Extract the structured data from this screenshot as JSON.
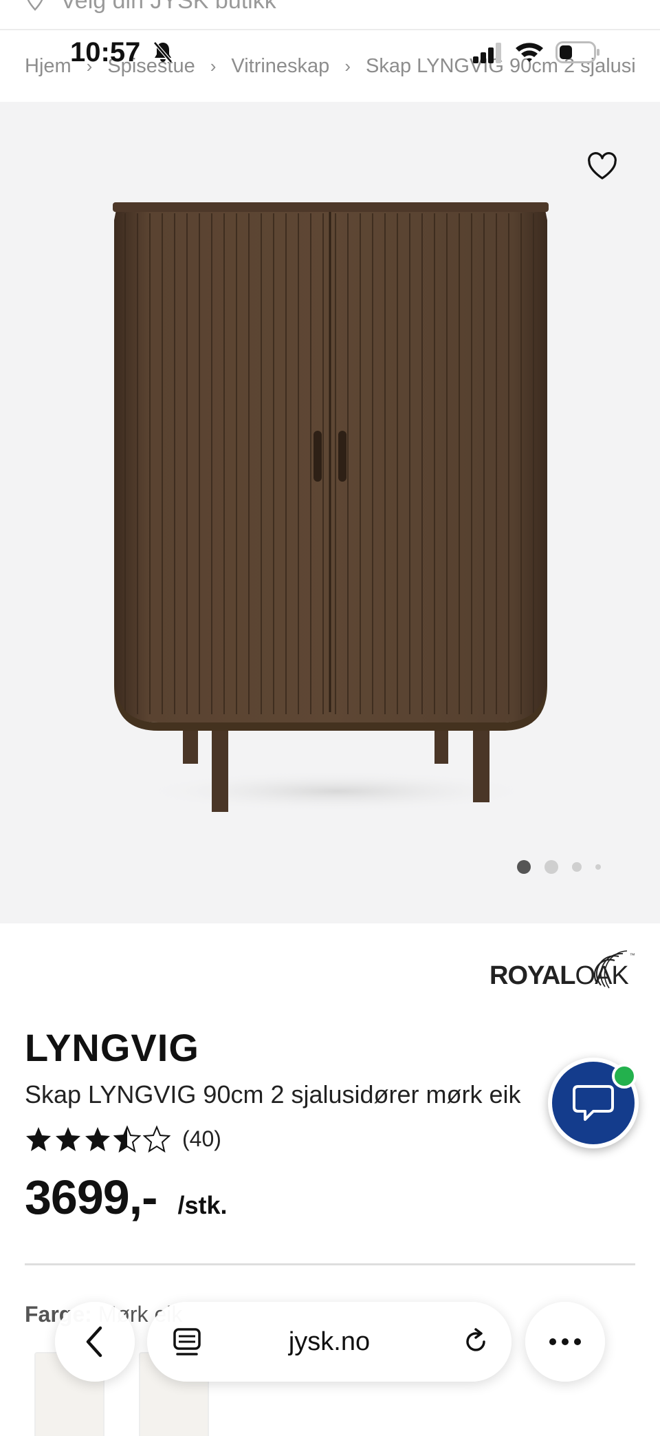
{
  "store": {
    "text": "Velg din JYSK butikk",
    "icon": "location-pin-icon"
  },
  "status_bar": {
    "time": "10:57",
    "icons": [
      "bell-slash-icon",
      "signal-icon",
      "wifi-icon",
      "battery-icon"
    ]
  },
  "breadcrumb": {
    "items": [
      "Hjem",
      "Spisestue",
      "Vitrineskap",
      "Skap LYNGVIG 90cm 2 sjalusi"
    ],
    "separator": "›"
  },
  "gallery": {
    "favorite_icon": "heart-icon",
    "image_label": "LYNGVIG cabinet",
    "dot_count": 4,
    "active_index": 0
  },
  "brand": {
    "part1": "ROYAL",
    "part2": "OAK",
    "tm": "™"
  },
  "product": {
    "name": "LYNGVIG",
    "description": "Skap LYNGVIG 90cm 2 sjalusidører mørk eik",
    "rating": 3.5,
    "rating_max": 5,
    "review_count": "(40)",
    "price": "3699,-",
    "unit": "/stk."
  },
  "color": {
    "label": "Farge:",
    "value": "Mørk eik"
  },
  "chat": {
    "icon": "chat-bubble-icon",
    "badge_color": "#23b14d",
    "bg_color": "#143c8c"
  },
  "browser": {
    "back_icon": "chevron-left-icon",
    "tabs_icon": "tabs-icon",
    "url": "jysk.no",
    "reload_icon": "reload-icon",
    "more_icon": "more-icon"
  },
  "colors": {
    "wood_dark": "#4e3a2b",
    "wood_mid": "#5e4734",
    "bg_gallery": "#f3f3f4"
  }
}
